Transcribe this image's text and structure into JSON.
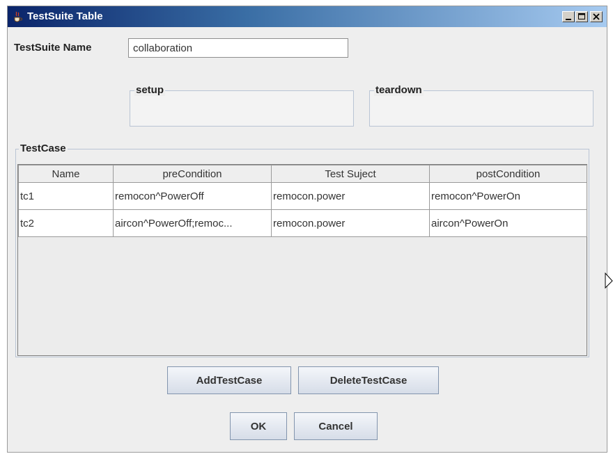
{
  "window": {
    "title": "TestSuite Table",
    "controls": {
      "minimize_icon": "minimize-icon",
      "maximize_icon": "maximize-icon",
      "close_icon": "close-icon"
    }
  },
  "form": {
    "name_label": "TestSuite Name",
    "name_value": "collaboration",
    "setup_label": "setup",
    "teardown_label": "teardown"
  },
  "testcase": {
    "group_label": "TestCase",
    "columns": [
      "Name",
      "preCondition",
      "Test Suject",
      "postCondition"
    ],
    "rows": [
      [
        "tc1",
        "remocon^PowerOff",
        "remocon.power",
        "remocon^PowerOn"
      ],
      [
        "tc2",
        "aircon^PowerOff;remoc...",
        "remocon.power",
        "aircon^PowerOn"
      ]
    ]
  },
  "buttons": {
    "add": "AddTestCase",
    "delete": "DeleteTestCase",
    "ok": "OK",
    "cancel": "Cancel"
  },
  "colors": {
    "title_gradient_start": "#0a246a",
    "title_gradient_end": "#a6caf0",
    "window_bg": "#eeeeee"
  }
}
